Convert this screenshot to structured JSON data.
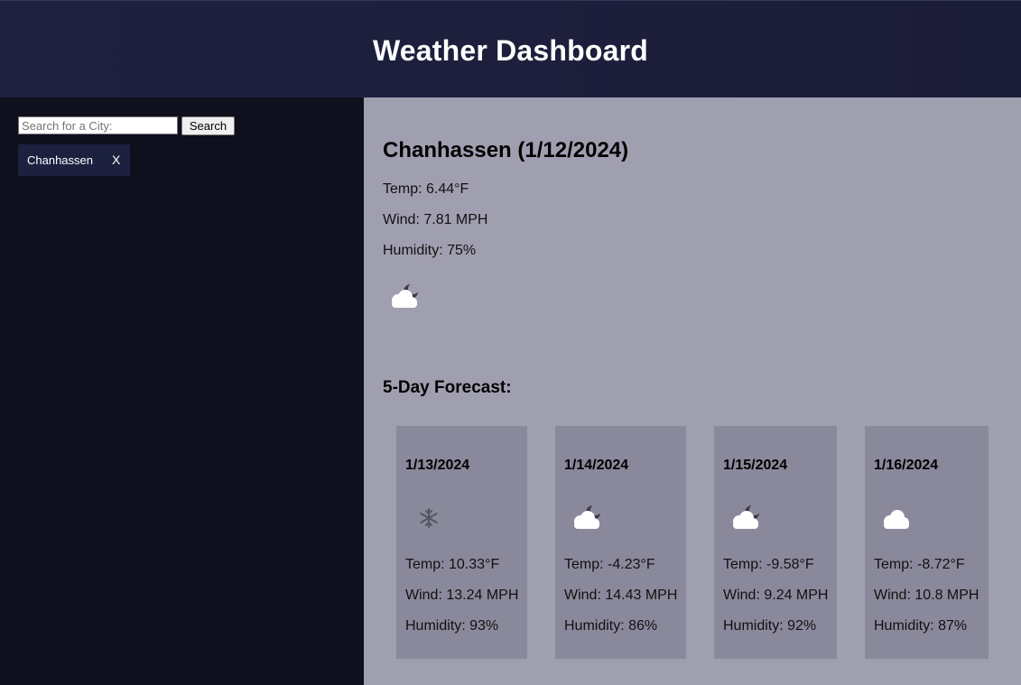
{
  "header": {
    "title": "Weather Dashboard"
  },
  "sidebar": {
    "search_placeholder": "Search for a City:",
    "search_button": "Search",
    "history": [
      {
        "city": "Chanhassen",
        "remove": "X"
      }
    ]
  },
  "current": {
    "title": "Chanhassen (1/12/2024)",
    "temp": "Temp: 6.44°F",
    "wind": "Wind: 7.81 MPH",
    "humidity": "Humidity: 75%",
    "icon": "cloud-moon-icon"
  },
  "forecast": {
    "title": "5-Day Forecast:",
    "days": [
      {
        "date": "1/13/2024",
        "icon": "snowflake-icon",
        "temp": "Temp: 10.33°F",
        "wind": "Wind: 13.24 MPH",
        "humidity": "Humidity: 93%"
      },
      {
        "date": "1/14/2024",
        "icon": "cloud-moon-icon",
        "temp": "Temp: -4.23°F",
        "wind": "Wind: 14.43 MPH",
        "humidity": "Humidity: 86%"
      },
      {
        "date": "1/15/2024",
        "icon": "cloud-moon-icon",
        "temp": "Temp: -9.58°F",
        "wind": "Wind: 9.24 MPH",
        "humidity": "Humidity: 92%"
      },
      {
        "date": "1/16/2024",
        "icon": "cloud-icon",
        "temp": "Temp: -8.72°F",
        "wind": "Wind: 10.8 MPH",
        "humidity": "Humidity: 87%"
      }
    ]
  },
  "colors": {
    "header_bg": "#1d1f3c",
    "sidebar_bg": "#100f1d",
    "main_bg": "#a09fb0",
    "card_bg": "#8a899c",
    "chip_bg": "#1d2140"
  }
}
